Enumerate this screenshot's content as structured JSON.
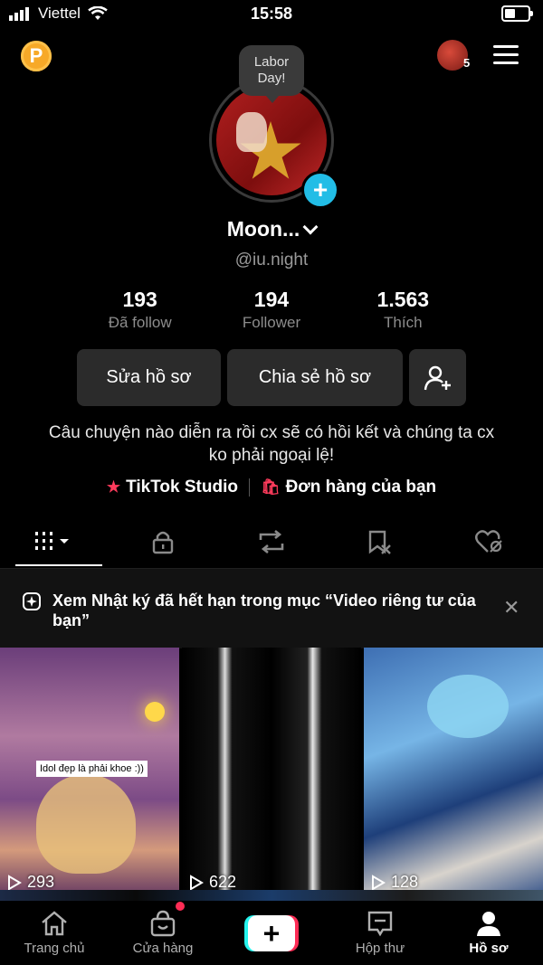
{
  "status_bar": {
    "carrier": "Viettel",
    "time": "15:58"
  },
  "header": {
    "coin_letter": "P",
    "account_count": "5"
  },
  "profile": {
    "bubble_line1": "Labor",
    "bubble_line2": "Day!",
    "name": "Moon...",
    "handle": "@iu.night",
    "stats": [
      {
        "value": "193",
        "label": "Đã follow"
      },
      {
        "value": "194",
        "label": "Follower"
      },
      {
        "value": "1.563",
        "label": "Thích"
      }
    ],
    "edit_label": "Sửa hồ sơ",
    "share_label": "Chia sẻ hồ sơ",
    "bio": "Câu chuyện nào diễn ra rồi cx sẽ có hồi kết và chúng ta cx ko phải ngoại lệ!",
    "studio_label": "TikTok Studio",
    "orders_label": "Đơn hàng của bạn"
  },
  "notice": {
    "text": "Xem Nhật ký đã hết hạn trong mục “Video riêng tư của bạn”"
  },
  "videos": [
    {
      "views": "293",
      "caption": "Idol đẹp là phải khoe :))"
    },
    {
      "views": "622"
    },
    {
      "views": "128"
    }
  ],
  "nav": {
    "home": "Trang chủ",
    "shop": "Cửa hàng",
    "inbox": "Hộp thư",
    "profile": "Hồ sơ"
  },
  "colors": {
    "accent_pink": "#fe2c55",
    "accent_cyan": "#25f4ee",
    "badge_blue": "#22bde6",
    "coin": "#f7a928"
  }
}
